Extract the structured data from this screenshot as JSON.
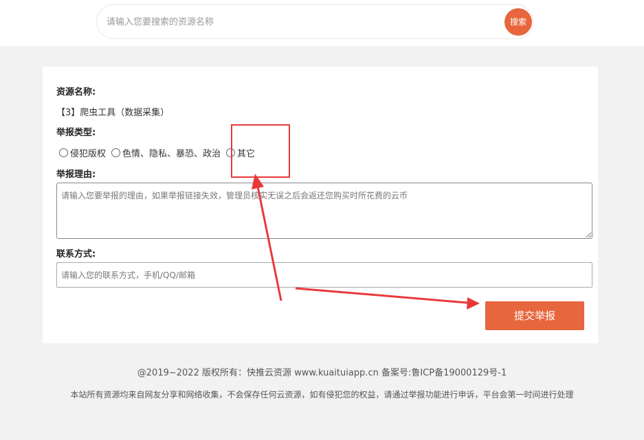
{
  "search": {
    "placeholder": "请输入您要搜索的资源名称",
    "button_label": "搜索"
  },
  "form": {
    "resource_label": "资源名称:",
    "resource_value": "【3】爬虫工具（数据采集）",
    "type_label": "举报类型:",
    "type_options": [
      "侵犯版权",
      "色情、隐私、暴恐、政治",
      "其它"
    ],
    "reason_label": "举报理由:",
    "reason_placeholder": "请输入您要举报的理由，如果举报链接失效，管理员核实无误之后会返还您购买时所花费的云币",
    "contact_label": "联系方式:",
    "contact_placeholder": "请输入您的联系方式，手机/QQ/邮箱",
    "submit_label": "提交举报"
  },
  "footer": {
    "copyright": "@2019~2022 版权所有：快推云资源 www.kuaituiapp.cn 备案号:鲁ICP备19000129号-1",
    "disclaimer": "本站所有资源均来自网友分享和网络收集，不会保存任何云资源，如有侵犯您的权益，请通过举报功能进行申诉，平台会第一时间进行处理"
  },
  "colors": {
    "accent": "#e8663d",
    "annotation": "#e8393a",
    "page_background": "#f2f2f2"
  }
}
